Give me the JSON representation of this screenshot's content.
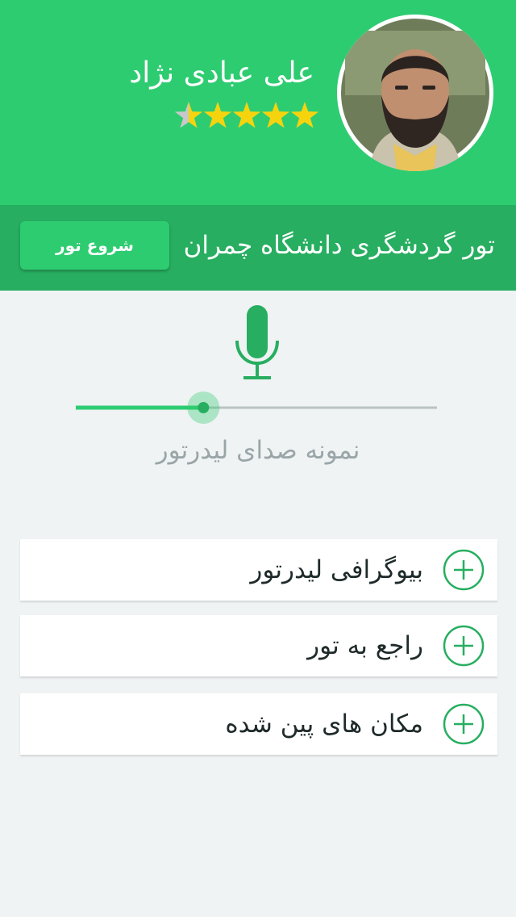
{
  "colors": {
    "primary": "#2ecc71",
    "primary_dark": "#27ae60",
    "mic": "#27ae60",
    "star": "#f5d40f",
    "background": "#eff3f3",
    "text_muted": "#9aa5a8"
  },
  "profile": {
    "name": "علی عبادی نژاد",
    "avatar_icon": "user-photo",
    "rating": 4.5,
    "rating_max": 5
  },
  "tour": {
    "title": "تور گردشگری دانشگاه چمران",
    "start_label": "شروع تور"
  },
  "voice_sample": {
    "icon": "microphone-icon",
    "progress": 0.34,
    "label": "نمونه صدای لیدرتور"
  },
  "sections": [
    {
      "label": "بیوگرافی لیدرتور",
      "icon": "plus-circle-icon"
    },
    {
      "label": "راجع به تور",
      "icon": "plus-circle-icon"
    },
    {
      "label": "مکان های پین شده",
      "icon": "plus-circle-icon"
    }
  ]
}
